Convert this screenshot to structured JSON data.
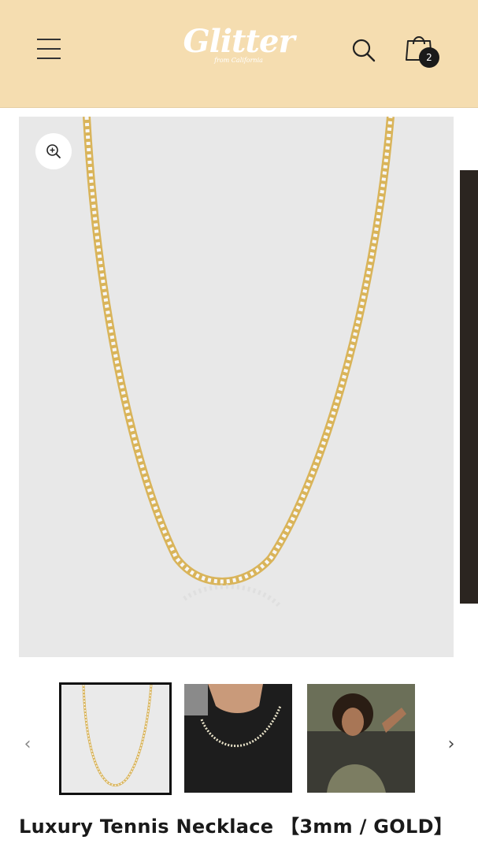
{
  "header": {
    "menu_icon": "hamburger-menu-icon",
    "logo_text": "Glitter",
    "logo_subtext": "from California",
    "search_icon": "search-icon",
    "cart_icon": "shopping-bag-icon",
    "cart_count": "2",
    "background_color": "#f5ddb0"
  },
  "gallery": {
    "zoom_icon": "zoom-in-icon",
    "main_image": "gold tennis necklace on grey background",
    "prev_icon": "chevron-left-icon",
    "next_icon": "chevron-right-icon",
    "prev_label": "‹",
    "next_label": "›",
    "thumbnails": [
      {
        "name": "necklace-product-thumbnail",
        "selected": true
      },
      {
        "name": "necklace-on-model-neck-thumbnail",
        "selected": false
      },
      {
        "name": "model-wearing-necklace-thumbnail",
        "selected": false
      }
    ]
  },
  "product": {
    "title": "Luxury Tennis Necklace 【3mm / GOLD】"
  }
}
